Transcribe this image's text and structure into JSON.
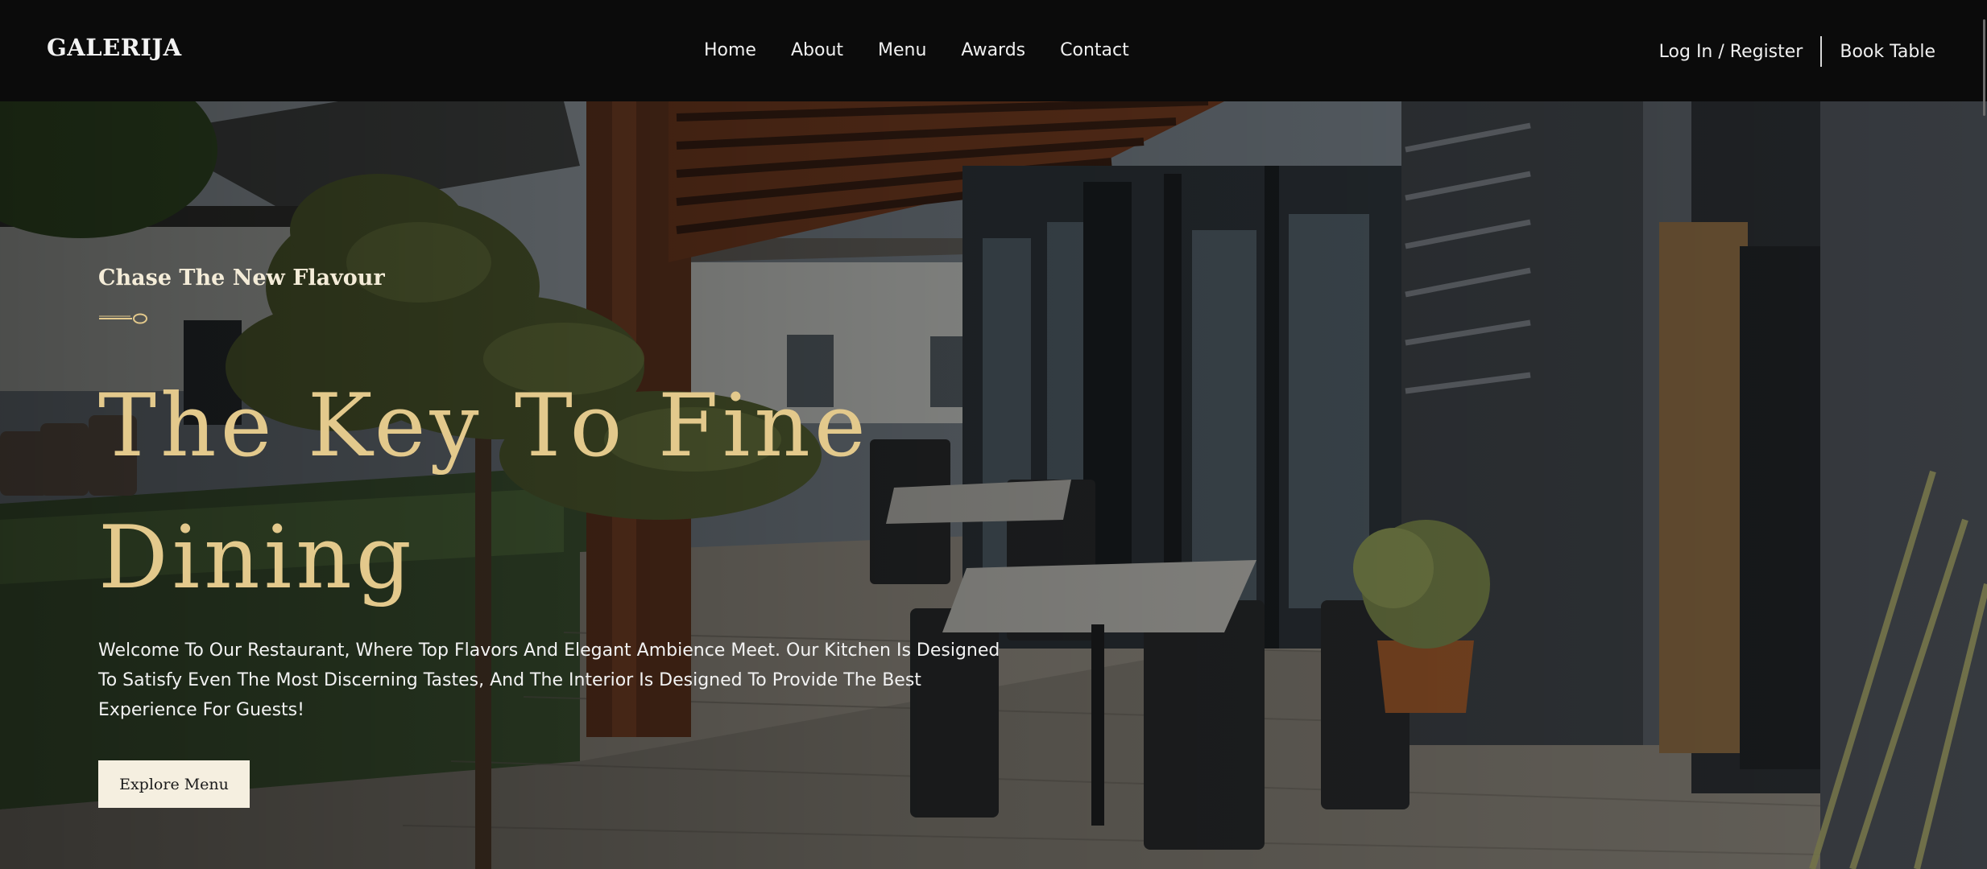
{
  "header": {
    "logo": "GALERIJA",
    "nav": [
      "Home",
      "About",
      "Menu",
      "Awards",
      "Contact"
    ],
    "login_label": "Log In / Register",
    "book_label": "Book Table"
  },
  "hero": {
    "tagline": "Chase The New Flavour",
    "divider_icon": "spoon-icon",
    "headline": "The Key To Fine Dining",
    "intro": "Welcome To Our Restaurant, Where Top Flavors And Elegant Ambience Meet. Our Kitchen Is Designed To Satisfy Even The Most Discerning Tastes, And The Interior Is Designed To Provide The Best Experience For Guests!",
    "cta_label": "Explore Menu"
  },
  "colors": {
    "header_bg": "#0b0b0b",
    "headline": "#e3c98c",
    "button_bg": "#f5efe0",
    "text": "#f0f0f0"
  }
}
